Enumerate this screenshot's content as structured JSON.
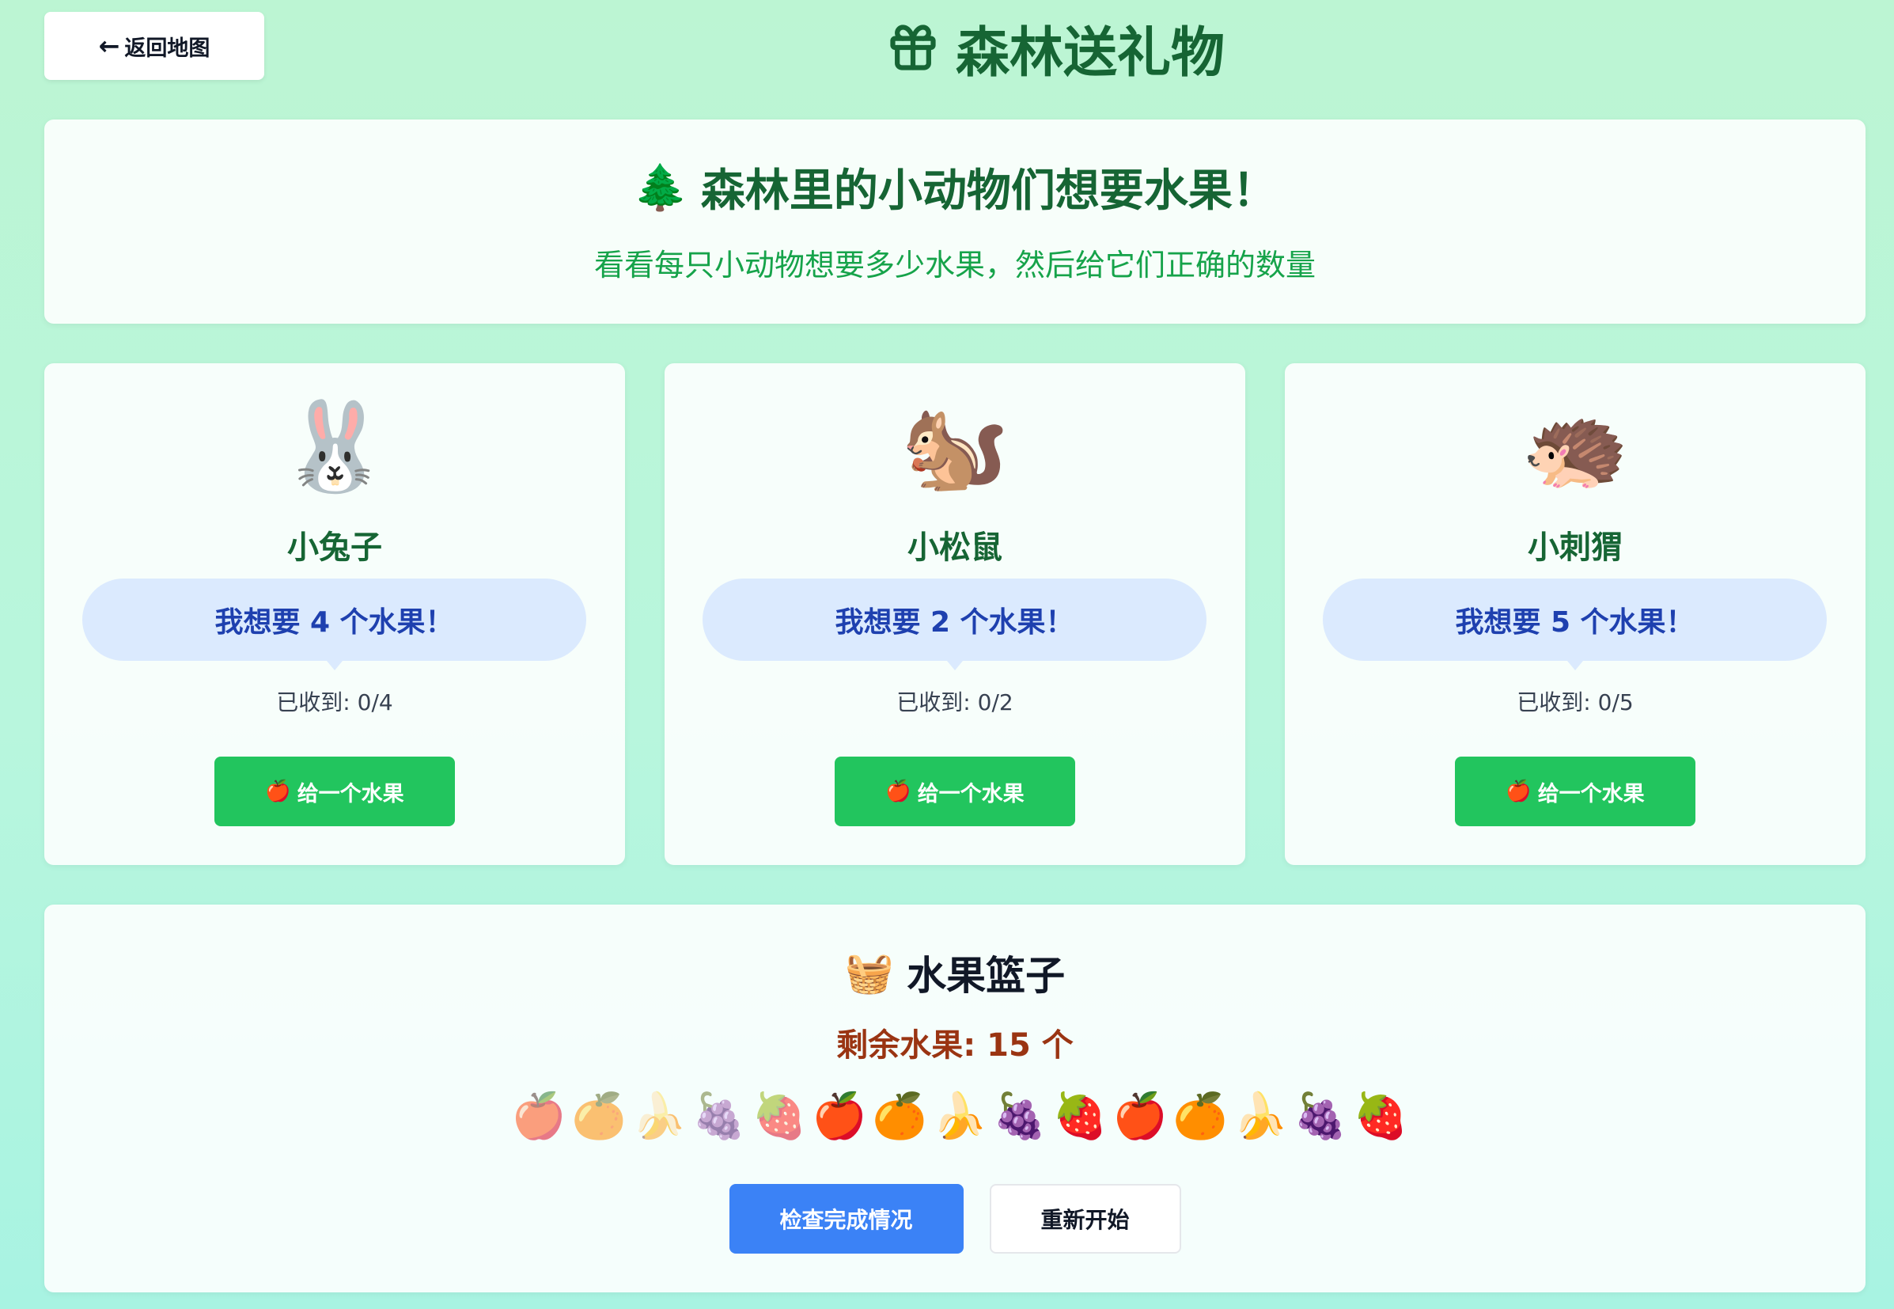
{
  "header": {
    "back_label": "返回地图",
    "back_arrow": "←",
    "title": "森林送礼物",
    "title_icon": "gift-icon"
  },
  "intro": {
    "icon": "🌲",
    "title": "森林里的小动物们想要水果！",
    "subtitle": "看看每只小动物想要多少水果，然后给它们正确的数量"
  },
  "animals": [
    {
      "emoji": "🐰",
      "name": "小兔子",
      "wants": 4,
      "request": "我想要 4 个水果！",
      "received": "已收到: 0/4",
      "button_icon": "🍎",
      "button_label": "给一个水果"
    },
    {
      "emoji": "🐿️",
      "name": "小松鼠",
      "wants": 2,
      "request": "我想要 2 个水果！",
      "received": "已收到: 0/2",
      "button_icon": "🍎",
      "button_label": "给一个水果"
    },
    {
      "emoji": "🦔",
      "name": "小刺猬",
      "wants": 5,
      "request": "我想要 5 个水果！",
      "received": "已收到: 0/5",
      "button_icon": "🍎",
      "button_label": "给一个水果"
    }
  ],
  "basket": {
    "icon": "🧺",
    "title": "水果篮子",
    "remaining": "剩余水果: 15 个",
    "remaining_count": 15,
    "fruits": [
      {
        "emoji": "🍎",
        "faded": true
      },
      {
        "emoji": "🍊",
        "faded": true
      },
      {
        "emoji": "🍌",
        "faded": true
      },
      {
        "emoji": "🍇",
        "faded": true
      },
      {
        "emoji": "🍓",
        "faded": true
      },
      {
        "emoji": "🍎",
        "faded": false
      },
      {
        "emoji": "🍊",
        "faded": false
      },
      {
        "emoji": "🍌",
        "faded": false
      },
      {
        "emoji": "🍇",
        "faded": false
      },
      {
        "emoji": "🍓",
        "faded": false
      },
      {
        "emoji": "🍎",
        "faded": false
      },
      {
        "emoji": "🍊",
        "faded": false
      },
      {
        "emoji": "🍌",
        "faded": false
      },
      {
        "emoji": "🍇",
        "faded": false
      },
      {
        "emoji": "🍓",
        "faded": false
      }
    ],
    "check_label": "检查完成情况",
    "restart_label": "重新开始"
  },
  "colors": {
    "title_green": "#166534",
    "subtitle_green": "#16a34a",
    "button_green": "#22c55e",
    "bubble_blue": "#dbeafe",
    "bubble_text": "#1e40af",
    "remaining_brown": "#9a3412",
    "check_blue": "#3b82f6"
  }
}
